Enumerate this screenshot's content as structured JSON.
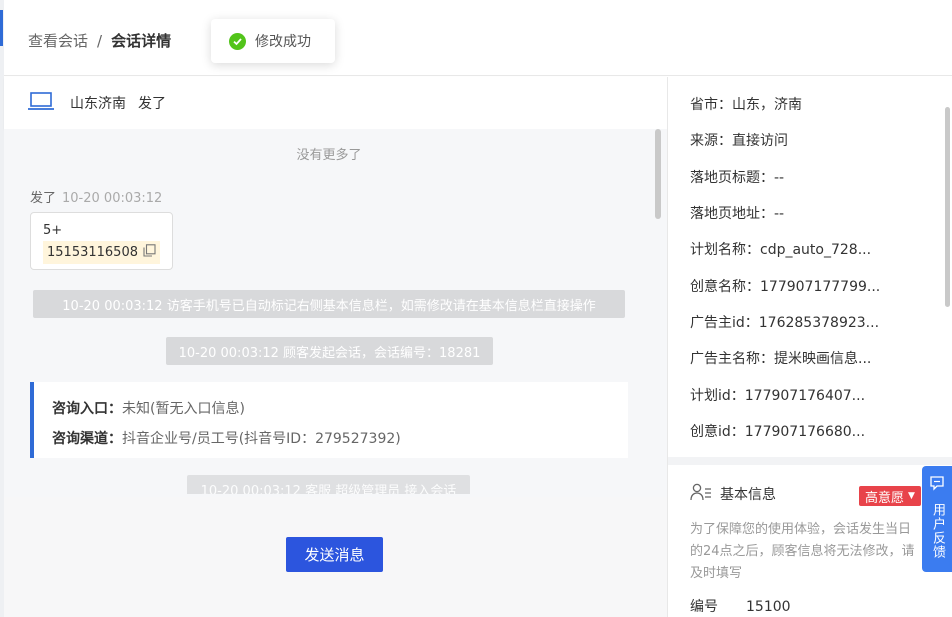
{
  "breadcrumb": {
    "parent": "查看会话",
    "separator": "/",
    "current": "会话详情"
  },
  "toast": {
    "text": "修改成功"
  },
  "chat": {
    "location": "山东济南",
    "visitor_name": "发了",
    "no_more": "没有更多了",
    "sender_name": "发了",
    "sender_time": "10-20 00:03:12",
    "bubble_line1": "5+",
    "bubble_phone": "15153116508",
    "system_messages": [
      "10-20 00:03:12 访客手机号已自动标记右侧基本信息栏，如需修改请在基本信息栏直接操作",
      "10-20 00:03:12 顾客发起会话，会话编号：18281",
      "10-20 00:03:12 客服 超级管理员 接入会话"
    ],
    "consult": {
      "entry_label": "咨询入口：",
      "entry_value": "未知(暂无入口信息)",
      "channel_label": "咨询渠道：",
      "channel_value": "抖音企业号/员工号(抖音号ID：279527392)"
    },
    "send_label": "发送消息"
  },
  "info": {
    "rows": [
      "省市：山东，济南",
      "来源：直接访问",
      "落地页标题：--",
      "落地页地址：--",
      "计划名称：cdp_auto_728...",
      "创意名称：177907177799...",
      "广告主id：176285378923...",
      "广告主名称：提米映画信息...",
      "计划id：177907176407...",
      "创意id：177907176680..."
    ]
  },
  "basic": {
    "title": "基本信息",
    "intent": "高意愿",
    "note": "为了保障您的使用体验，会话发生当日的24点之后，顾客信息将无法修改，请及时填写",
    "field_label": "编号",
    "field_value": "15100"
  },
  "feedback": {
    "label": "用户反馈"
  },
  "colors": {
    "primary": "#2c55de",
    "accent": "#2f6bd6",
    "success": "#52c41a",
    "danger": "#e8434a"
  }
}
